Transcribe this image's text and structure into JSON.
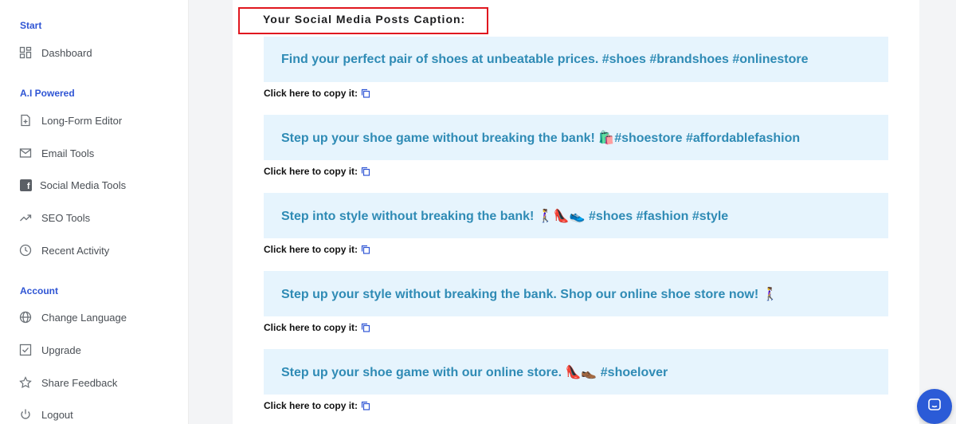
{
  "sidebar": {
    "sections": [
      {
        "title": "Start",
        "items": [
          {
            "label": "Dashboard",
            "icon": "dashboard-icon"
          }
        ]
      },
      {
        "title": "A.I Powered",
        "items": [
          {
            "label": "Long-Form Editor",
            "icon": "document-plus-icon"
          },
          {
            "label": "Email Tools",
            "icon": "mail-icon"
          },
          {
            "label": "Social Media Tools",
            "icon": "facebook-icon"
          },
          {
            "label": "SEO Tools",
            "icon": "trending-up-icon"
          },
          {
            "label": "Recent Activity",
            "icon": "clock-icon"
          }
        ]
      },
      {
        "title": "Account",
        "items": [
          {
            "label": "Change Language",
            "icon": "globe-icon"
          },
          {
            "label": "Upgrade",
            "icon": "checkbox-icon"
          },
          {
            "label": "Share Feedback",
            "icon": "star-icon"
          },
          {
            "label": "Logout",
            "icon": "power-icon"
          }
        ]
      }
    ]
  },
  "main": {
    "heading": "Your Social Media Posts Caption:",
    "copy_label": "Click here to copy it:",
    "posts": [
      {
        "text": "Find your perfect pair of shoes at unbeatable prices. #shoes #brandshoes #onlinestore"
      },
      {
        "text": "Step up your shoe game without breaking the bank! 🛍️#shoestore #affordablefashion"
      },
      {
        "text": "Step into style without breaking the bank! 🚶‍♀️👠👟 #shoes #fashion #style"
      },
      {
        "text": "Step up your style without breaking the bank. Shop our online shoe store now! 🚶‍♀️"
      },
      {
        "text": "Step up your shoe game with our online store. 👠👞 #shoelover"
      }
    ]
  },
  "colors": {
    "accent": "#2f55d4",
    "post_bg": "#e6f4fd",
    "post_text": "#2f8bb5",
    "highlight": "#e0171f",
    "chat": "#2b5bd7"
  }
}
